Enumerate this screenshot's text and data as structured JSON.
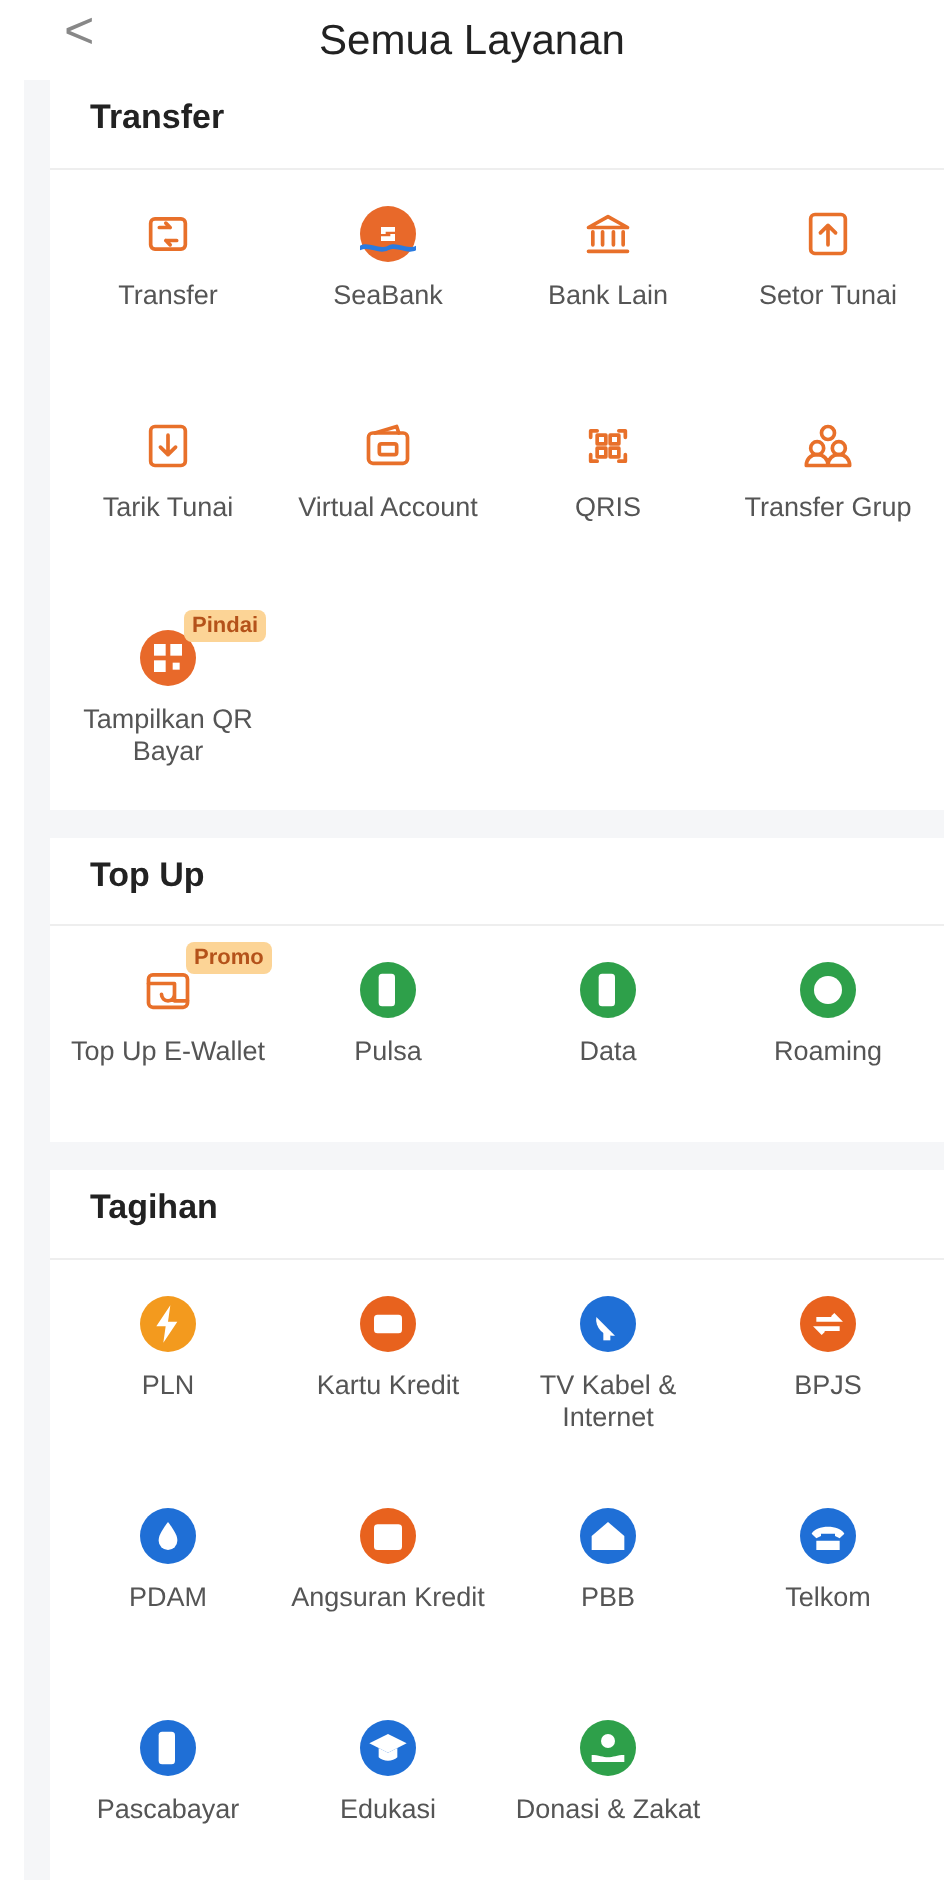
{
  "header": {
    "back": "<",
    "title": "Semua Layanan"
  },
  "sections": [
    {
      "title": "Transfer",
      "items": [
        {
          "label": "Transfer",
          "kind": "outline"
        },
        {
          "label": "SeaBank",
          "kind": "filled",
          "color": "#e8692a"
        },
        {
          "label": "Bank Lain",
          "kind": "outline"
        },
        {
          "label": "Setor Tunai",
          "kind": "outline"
        },
        {
          "label": "Tarik Tunai",
          "kind": "outline"
        },
        {
          "label": "Virtual Account",
          "kind": "outline"
        },
        {
          "label": "QRIS",
          "kind": "outline"
        },
        {
          "label": "Transfer Grup",
          "kind": "outline"
        },
        {
          "label": "Tampilkan QR Bayar",
          "kind": "filled",
          "color": "#e8692a",
          "badge": "Pindai"
        }
      ]
    },
    {
      "title": "Top Up",
      "items": [
        {
          "label": "Top Up E-Wallet",
          "kind": "outline",
          "badge": "Promo"
        },
        {
          "label": "Pulsa",
          "kind": "filled",
          "color": "#2ea04a"
        },
        {
          "label": "Data",
          "kind": "filled",
          "color": "#2ea04a"
        },
        {
          "label": "Roaming",
          "kind": "filled",
          "color": "#2ea04a"
        }
      ]
    },
    {
      "title": "Tagihan",
      "items": [
        {
          "label": "PLN",
          "kind": "filled",
          "color": "#f39a1e"
        },
        {
          "label": "Kartu Kredit",
          "kind": "filled",
          "color": "#e8621e"
        },
        {
          "label": "TV Kabel & Internet",
          "kind": "filled",
          "color": "#1f6fd6"
        },
        {
          "label": "BPJS",
          "kind": "filled",
          "color": "#e8621e"
        },
        {
          "label": "PDAM",
          "kind": "filled",
          "color": "#1f6fd6"
        },
        {
          "label": "Angsuran Kredit",
          "kind": "filled",
          "color": "#e8621e"
        },
        {
          "label": "PBB",
          "kind": "filled",
          "color": "#1f6fd6"
        },
        {
          "label": "Telkom",
          "kind": "filled",
          "color": "#1f6fd6"
        },
        {
          "label": "Pascabayar",
          "kind": "filled",
          "color": "#1f6fd6"
        },
        {
          "label": "Edukasi",
          "kind": "filled",
          "color": "#1f6fd6"
        },
        {
          "label": "Donasi & Zakat",
          "kind": "filled",
          "color": "#2ea04a"
        }
      ]
    }
  ]
}
